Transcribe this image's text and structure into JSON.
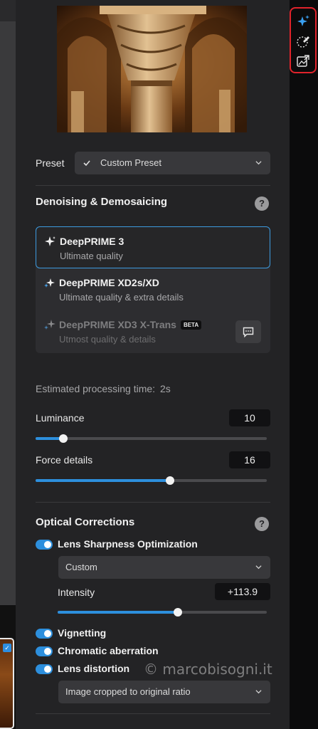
{
  "preset": {
    "label": "Preset",
    "value": "Custom Preset"
  },
  "denoising": {
    "title": "Denoising & Demosaicing",
    "help": "?",
    "options": [
      {
        "title": "DeepPRIME 3",
        "subtitle": "Ultimate quality",
        "selected": true
      },
      {
        "title": "DeepPRIME XD2s/XD",
        "subtitle": "Ultimate quality & extra details",
        "selected": false
      },
      {
        "title": "DeepPRIME XD3 X-Trans",
        "badge": "BETA",
        "subtitle": "Utmost quality & details",
        "selected": false,
        "disabled": true
      }
    ],
    "estimated_label": "Estimated processing time:",
    "estimated_value": "2s",
    "luminance": {
      "label": "Luminance",
      "value": "10",
      "fraction": 0.12
    },
    "force_details": {
      "label": "Force details",
      "value": "16",
      "fraction": 0.58
    }
  },
  "optical": {
    "title": "Optical Corrections",
    "help": "?",
    "lens_sharpness": {
      "label": "Lens Sharpness Optimization",
      "on": true
    },
    "sharpness_mode": "Custom",
    "intensity": {
      "label": "Intensity",
      "value": "+113.9",
      "fraction": 0.575
    },
    "vignetting": {
      "label": "Vignetting",
      "on": true
    },
    "chromatic": {
      "label": "Chromatic aberration",
      "on": true
    },
    "distortion": {
      "label": "Lens distortion",
      "on": true
    },
    "crop_mode": "Image cropped to original ratio"
  },
  "watermark": "© marcobisogni.it",
  "toolbar_icons": [
    "sparkle-ai-icon",
    "brush-mask-icon",
    "export-image-icon"
  ],
  "colors": {
    "accent": "#2d8fdd",
    "highlight_frame": "#e0232b",
    "panel": "#232325"
  }
}
